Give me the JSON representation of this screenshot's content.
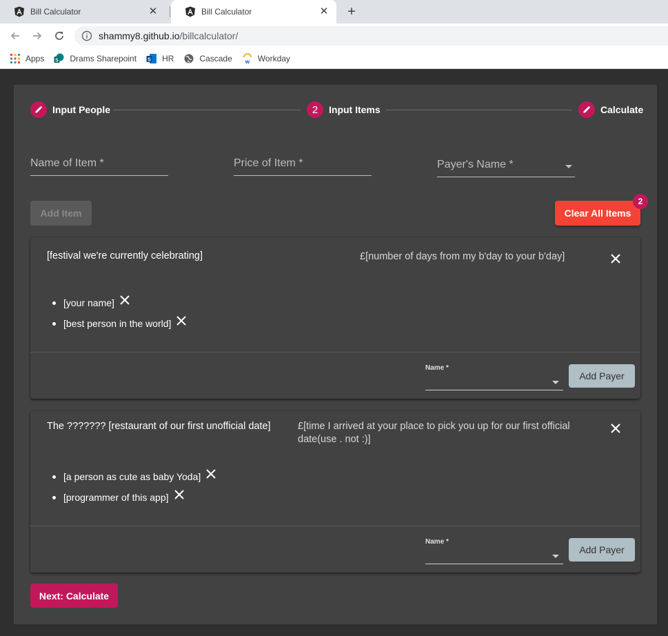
{
  "browser": {
    "tabs": [
      {
        "title": "Bill Calculator"
      },
      {
        "title": "Bill Calculator"
      }
    ],
    "url_host": "shammy8.github.io",
    "url_path": "/billcalculator/",
    "bookmarks": [
      {
        "label": "Apps"
      },
      {
        "label": "Drams Sharepoint"
      },
      {
        "label": "HR"
      },
      {
        "label": "Cascade"
      },
      {
        "label": "Workday"
      }
    ]
  },
  "stepper": {
    "steps": [
      {
        "label": "Input People",
        "badge": ""
      },
      {
        "label": "Input Items",
        "badge": "2"
      },
      {
        "label": "Calculate",
        "badge": ""
      }
    ]
  },
  "form": {
    "item_name_label": "Name of Item *",
    "item_price_label": "Price of Item *",
    "payer_name_label": "Payer's Name *",
    "add_item_label": "Add Item",
    "clear_all_label": "Clear All Items",
    "clear_badge": "2"
  },
  "items": [
    {
      "name": "[festival we're currently celebrating]",
      "price": "£[number of days from my b'day to your b'day]",
      "payers": [
        "[your name]",
        "[best person in the world]"
      ],
      "name_field_label": "Name *",
      "add_payer_label": "Add Payer"
    },
    {
      "name": "The ??????? [restaurant of our first unofficial date]",
      "price_line1": "£[time I arrived at your place to pick you up for our first official",
      "price_line2": "date(use . not :)]",
      "payers": [
        "[a person as cute as baby Yoda]",
        "[programmer of this app]"
      ],
      "name_field_label": "Name *",
      "add_payer_label": "Add Payer"
    }
  ],
  "next_label": "Next: Calculate",
  "colors": {
    "accent": "#c2185b",
    "warn": "#f44336",
    "card": "#424242",
    "background": "#2f2f2f"
  }
}
